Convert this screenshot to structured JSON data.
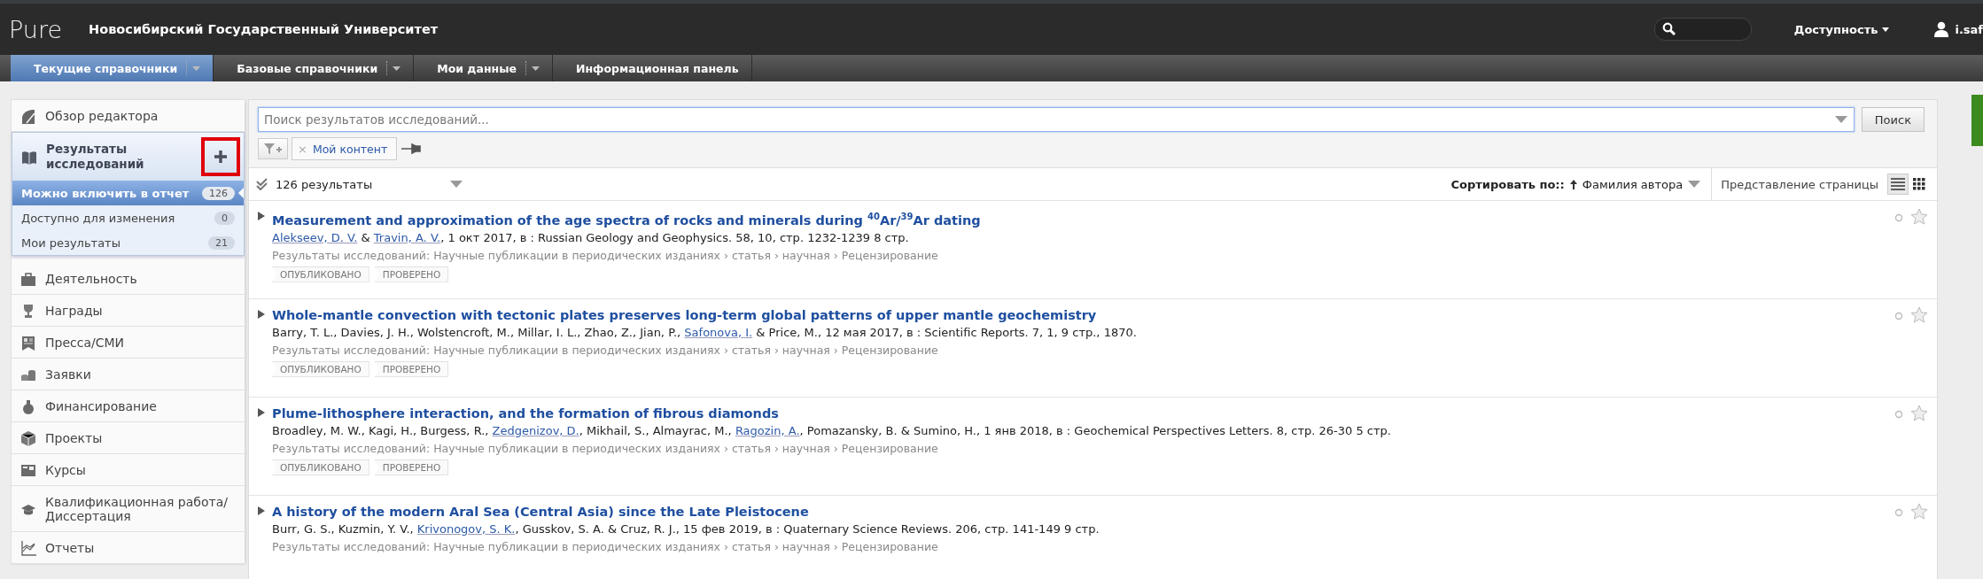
{
  "header": {
    "logo": "Pure",
    "title": "Новосибирский Государственный Университет",
    "accessibility": "Доступность",
    "user": "i.saf"
  },
  "nav": [
    {
      "label": "Текущие справочники",
      "selected": true,
      "dropdown": true
    },
    {
      "label": "Базовые справочники",
      "selected": false,
      "dropdown": true
    },
    {
      "label": "Мои данные",
      "selected": false,
      "dropdown": true
    },
    {
      "label": "Информационная панель",
      "selected": false,
      "dropdown": false
    }
  ],
  "sidebar": {
    "items": [
      {
        "kind": "link",
        "label": "Обзор редактора"
      },
      {
        "kind": "group",
        "label": "Результаты исследований",
        "expanded": true,
        "add_highlighted": true,
        "children": [
          {
            "label": "Можно включить в отчет",
            "count": "126",
            "selected": true
          },
          {
            "label": "Доступно для изменения",
            "count": "0",
            "selected": false
          },
          {
            "label": "Мои результаты",
            "count": "21",
            "selected": false
          }
        ]
      },
      {
        "kind": "link",
        "label": "Деятельность"
      },
      {
        "kind": "link",
        "label": "Награды"
      },
      {
        "kind": "link",
        "label": "Пресса/СМИ"
      },
      {
        "kind": "link",
        "label": "Заявки"
      },
      {
        "kind": "link",
        "label": "Финансирование"
      },
      {
        "kind": "link",
        "label": "Проекты"
      },
      {
        "kind": "link",
        "label": "Курсы"
      },
      {
        "kind": "link",
        "label": "Квалификационная работа/ Диссертация"
      },
      {
        "kind": "link",
        "label": "Отчеты"
      }
    ]
  },
  "search": {
    "placeholder": "Поиск результатов исследований...",
    "button": "Поиск",
    "filters": [
      {
        "label": "Мой контент",
        "remove": "×"
      }
    ]
  },
  "toolbar": {
    "count": "126 результаты",
    "sort_label": "Сортировать по::",
    "sort_value": "Фамилия автора",
    "view_label": "Представление страницы",
    "views": [
      {
        "selected": true
      },
      {
        "selected": false
      }
    ]
  },
  "results": [
    {
      "title": "Measurement and approximation of the age spectra of rocks and minerals during $^{40}$Ar/$^{39}$Ar dating",
      "byline": [
        {
          "text": "Alekseev, D. V.",
          "link": true
        },
        {
          "text": " & ",
          "link": false
        },
        {
          "text": "Travin, A. V.",
          "link": true
        },
        {
          "text": ", 1 окт 2017, в : Russian Geology and Geophysics. 58, 10, стр. 1232-1239 8 стр.",
          "link": false
        }
      ],
      "category": "Результаты исследований: Научные публикации в периодических изданиях › статья › научная › Рецензирование",
      "tags": [
        "ОПУБЛИКОВАНО",
        "ПРОВЕРЕНО"
      ]
    },
    {
      "title": "Whole-mantle convection with tectonic plates preserves long-term global patterns of upper mantle geochemistry",
      "byline": [
        {
          "text": "Barry, T. L., Davies, J. H., Wolstencroft, M., Millar, I. L., Zhao, Z., Jian, P., ",
          "link": false
        },
        {
          "text": "Safonova, I.",
          "link": true
        },
        {
          "text": " & Price, M., 12 мая 2017, в : Scientific Reports. 7, 1, 9 стр., 1870.",
          "link": false
        }
      ],
      "category": "Результаты исследований: Научные публикации в периодических изданиях › статья › научная › Рецензирование",
      "tags": [
        "ОПУБЛИКОВАНО",
        "ПРОВЕРЕНО"
      ]
    },
    {
      "title": "Plume-lithosphere interaction, and the formation of fibrous diamonds",
      "byline": [
        {
          "text": "Broadley, M. W., Kagi, H., Burgess, R., ",
          "link": false
        },
        {
          "text": "Zedgenizov, D.",
          "link": true
        },
        {
          "text": ", Mikhail, S., Almayrac, M., ",
          "link": false
        },
        {
          "text": "Ragozin, A.",
          "link": true
        },
        {
          "text": ", Pomazansky, B. & Sumino, H., 1 янв 2018, в : Geochemical Perspectives Letters. 8, стр. 26-30 5 стр.",
          "link": false
        }
      ],
      "category": "Результаты исследований: Научные публикации в периодических изданиях › статья › научная › Рецензирование",
      "tags": [
        "ОПУБЛИКОВАНО",
        "ПРОВЕРЕНО"
      ]
    },
    {
      "title": "A history of the modern Aral Sea (Central Asia) since the Late Pleistocene",
      "byline": [
        {
          "text": "Burr, G. S., Kuzmin, Y. V., ",
          "link": false
        },
        {
          "text": "Krivonogov, S. K.",
          "link": true
        },
        {
          "text": ", Gusskov, S. A. & Cruz, R. J., 15 фев 2019, в : Quaternary Science Reviews. 206, стр. 141-149 9 стр.",
          "link": false
        }
      ],
      "category": "Результаты исследований: Научные публикации в периодических изданиях › статья › научная › Рецензирование"
    }
  ]
}
